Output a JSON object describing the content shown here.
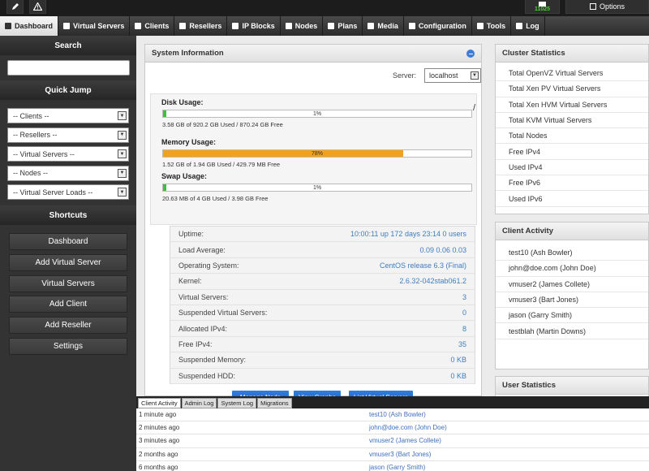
{
  "topbar": {
    "message_count": "11025",
    "options_label": "Options"
  },
  "nav": [
    {
      "label": "Dashboard",
      "icon": "home-icon"
    },
    {
      "label": "Virtual Servers",
      "icon": "grid-icon"
    },
    {
      "label": "Clients",
      "icon": "user-icon"
    },
    {
      "label": "Resellers",
      "icon": "user-icon"
    },
    {
      "label": "IP Blocks",
      "icon": "list-icon"
    },
    {
      "label": "Nodes",
      "icon": "server-icon"
    },
    {
      "label": "Plans",
      "icon": "document-icon"
    },
    {
      "label": "Media",
      "icon": "folder-icon"
    },
    {
      "label": "Configuration",
      "icon": "gear-icon"
    },
    {
      "label": "Tools",
      "icon": "wrench-icon"
    },
    {
      "label": "Log",
      "icon": "page-icon"
    }
  ],
  "sidebar": {
    "search_title": "Search",
    "quickjump_title": "Quick Jump",
    "quickjump": [
      "-- Clients --",
      "-- Resellers --",
      "-- Virtual Servers --",
      "-- Nodes --",
      "-- Virtual Server Loads --"
    ],
    "shortcuts_title": "Shortcuts",
    "shortcuts": [
      "Dashboard",
      "Add Virtual Server",
      "Virtual Servers",
      "Add Client",
      "Add Reseller",
      "Settings"
    ]
  },
  "system": {
    "title": "System Information",
    "server_label": "Server:",
    "server_value": "localhost",
    "disk": {
      "title": "Disk Usage:",
      "percent": 1,
      "pct_label": "1%",
      "sub": "3.58 GB of 920.2 GB Used / 870.24 GB Free",
      "color": "#39c23a"
    },
    "memory": {
      "title": "Memory Usage:",
      "percent": 78,
      "pct_label": "78%",
      "sub": "1.52 GB of 1.94 GB Used / 429.79 MB Free",
      "color": "#f0a21b"
    },
    "swap": {
      "title": "Swap Usage:",
      "percent": 1,
      "pct_label": "1%",
      "sub": "20.63 MB of 4 GB Used / 3.98 GB Free",
      "color": "#39c23a"
    },
    "stats": [
      {
        "k": "Uptime:",
        "v": "10:00:11 up 172 days 23:14 0 users"
      },
      {
        "k": "Load Average:",
        "v": "0.09 0.06 0.03"
      },
      {
        "k": "Operating System:",
        "v": "CentOS release 6.3 (Final)"
      },
      {
        "k": "Kernel:",
        "v": "2.6.32-042stab061.2"
      },
      {
        "k": "Virtual Servers:",
        "v": "3"
      },
      {
        "k": "Suspended Virtual Servers:",
        "v": "0"
      },
      {
        "k": "Allocated IPv4:",
        "v": "8"
      },
      {
        "k": "Free IPv4:",
        "v": "35"
      },
      {
        "k": "Suspended Memory:",
        "v": "0 KB"
      },
      {
        "k": "Suspended HDD:",
        "v": "0 KB"
      }
    ],
    "buttons": [
      "Manage Node",
      "View Graphs",
      "List Virtual Servers"
    ]
  },
  "cluster": {
    "title": "Cluster Statistics",
    "rows": [
      "Total OpenVZ Virtual Servers",
      "Total Xen PV Virtual Servers",
      "Total Xen HVM Virtual Servers",
      "Total KVM Virtual Servers",
      "Total Nodes",
      "Free IPv4",
      "Used IPv4",
      "Free IPv6",
      "Used IPv6"
    ]
  },
  "client_activity": {
    "title": "Client Activity",
    "rows": [
      "test10 (Ash Bowler)",
      "john@doe.com (John Doe)",
      "vmuser2 (James Collete)",
      "vmuser3 (Bart Jones)",
      "jason (Garry Smith)",
      "testblah (Martin Downs)"
    ]
  },
  "user_stats": {
    "title": "User Statistics"
  },
  "log": {
    "tabs": [
      "Client Activity",
      "Admin Log",
      "System Log",
      "Migrations"
    ],
    "rows": [
      {
        "t": "1 minute ago",
        "u": "test10 (Ash Bowler)"
      },
      {
        "t": "2 minutes ago",
        "u": "john@doe.com (John Doe)"
      },
      {
        "t": "3 minutes ago",
        "u": "vmuser2 (James Collete)"
      },
      {
        "t": "2 months ago",
        "u": "vmuser3 (Bart Jones)"
      },
      {
        "t": "6 months ago",
        "u": "jason (Garry Smith)"
      }
    ]
  }
}
